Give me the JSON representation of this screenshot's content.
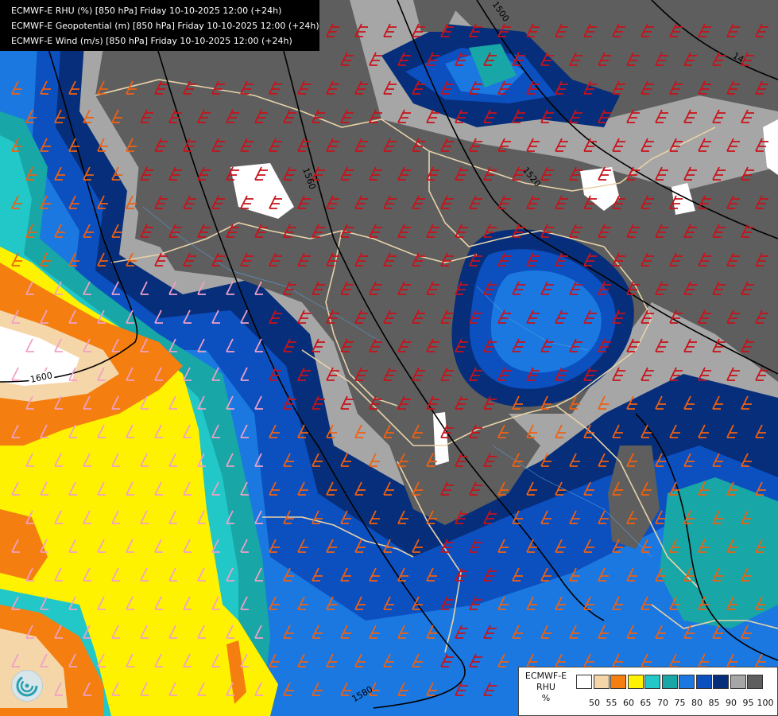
{
  "header": {
    "lines": [
      "ECMWF-E RHU (%) [850 hPa] Friday 10-10-2025 12:00 (+24h)",
      "ECMWF-E Geopotential (m) [850 hPa] Friday 10-10-2025 12:00 (+24h)",
      "ECMWF-E Wind (m/s) [850 hPa] Friday 10-10-2025 12:00 (+24h)"
    ]
  },
  "contour_labels": [
    "1500",
    "1560",
    "1520",
    "1600",
    "1580",
    "14"
  ],
  "legend": {
    "title_lines": [
      "ECMWF-E",
      "RHU",
      "%"
    ],
    "ticks": [
      "50",
      "55",
      "60",
      "65",
      "70",
      "75",
      "80",
      "85",
      "90",
      "95",
      "100"
    ],
    "colors": [
      "#ffffff",
      "#f5d6a8",
      "#f47e10",
      "#fff200",
      "#22c7c7",
      "#18a6a6",
      "#1a78e0",
      "#0c4fbf",
      "#062e7a",
      "#a6a6a6",
      "#5e5e5e"
    ]
  },
  "logo": {
    "icon": "ecmwf-swirl-logo-icon"
  },
  "map_colors": {
    "barb_red": "#c8121a",
    "barb_orange": "#f06010",
    "barb_pink": "#f0a0c8",
    "border": "#e8d2a8",
    "contour": "#000000"
  }
}
